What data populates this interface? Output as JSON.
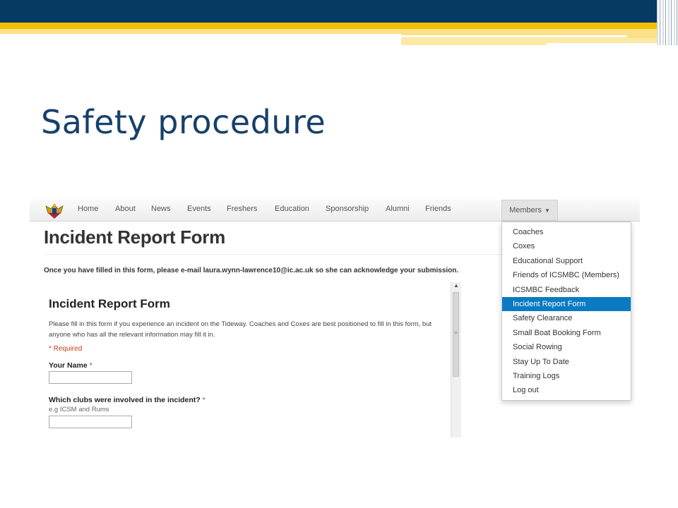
{
  "slide": {
    "title": "Safety procedure",
    "colors": {
      "navy": "#073a63",
      "gold": "#f2bf00",
      "title": "#17406b"
    }
  },
  "navbar": {
    "logo_icon": "club-crest-icon",
    "items": [
      "Home",
      "About",
      "News",
      "Events",
      "Freshers",
      "Education",
      "Sponsorship",
      "Alumni",
      "Friends"
    ],
    "members_label": "Members"
  },
  "page": {
    "heading": "Incident Report Form",
    "intro": "Once you have filled in this form, please e-mail laura.wynn-lawrence10@ic.ac.uk so she can acknowledge your submission."
  },
  "form": {
    "title": "Incident Report Form",
    "description": "Please fill in this form if you experience an incident on the Tideway. Coaches and Coxes are best positioned to fill in this form, but anyone who has all the relevant information may fill it in.",
    "required_note": "* Required",
    "fields": [
      {
        "label": "Your Name",
        "required_mark": "*",
        "help": "",
        "value": ""
      },
      {
        "label": "Which clubs were involved in the incident?",
        "required_mark": "*",
        "help": "e.g ICSM and Rums",
        "value": ""
      }
    ]
  },
  "dropdown": {
    "items": [
      "Coaches",
      "Coxes",
      "Educational Support",
      "Friends of ICSMBC (Members)",
      "ICSMBC Feedback",
      "Incident Report Form",
      "Safety Clearance",
      "Small Boat Booking Form",
      "Social Rowing",
      "Stay Up To Date",
      "Training Logs",
      "Log out"
    ],
    "active": "Incident Report Form",
    "active_color": "#0a7bc1"
  }
}
